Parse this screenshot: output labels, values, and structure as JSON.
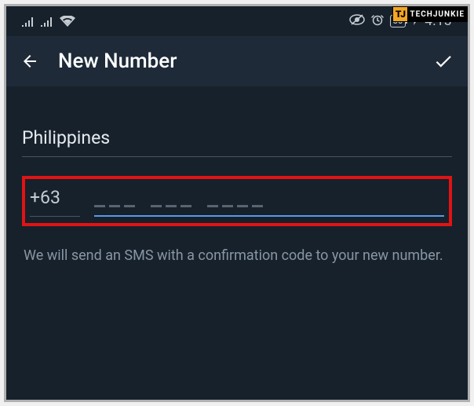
{
  "watermark": {
    "logo_text": "TJ",
    "brand_text": "TECHJUNKIE"
  },
  "statusbar": {
    "battery_percent": "30",
    "clock": "4:13"
  },
  "header": {
    "title": "New Number"
  },
  "form": {
    "country_label": "Philippines",
    "country_code": "+63",
    "help_text": "We will send an SMS with a confirmation code to your new number."
  }
}
